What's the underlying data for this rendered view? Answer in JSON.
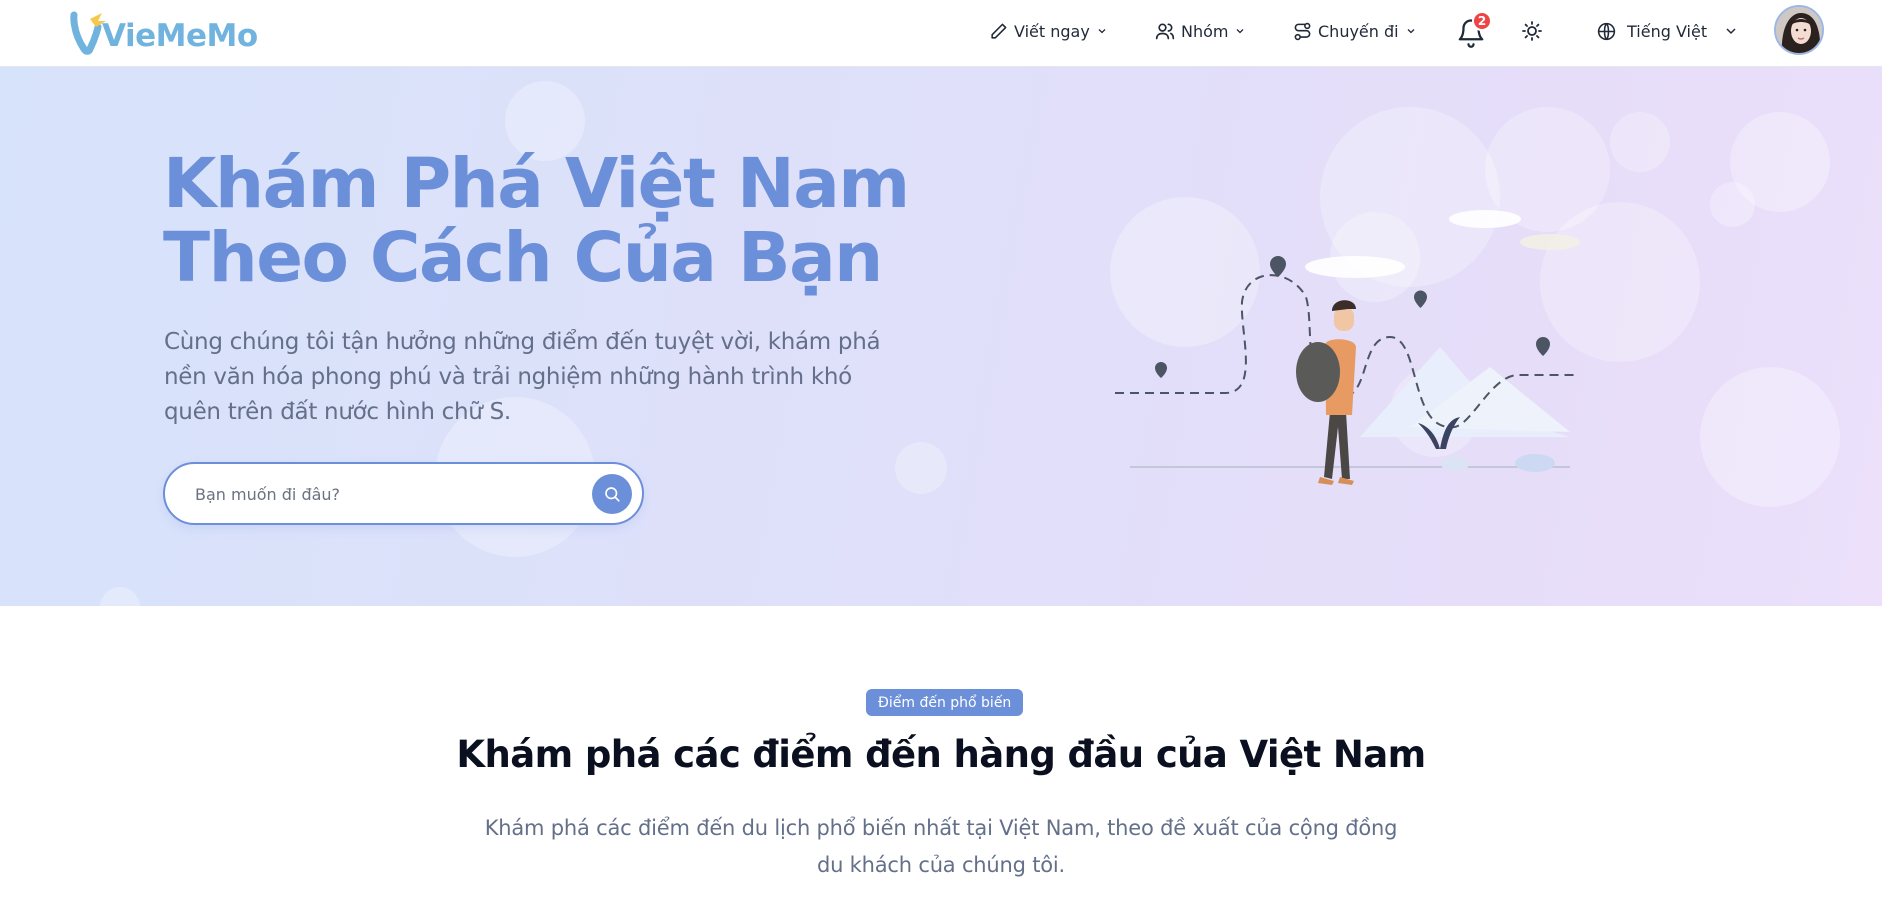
{
  "brand": {
    "logo_text": "VieMeMo"
  },
  "nav": {
    "write_label": "Viết ngay",
    "group_label": "Nhóm",
    "trip_label": "Chuyến đi",
    "notification_count": "2",
    "language_label": "Tiếng Việt"
  },
  "hero": {
    "title_line1": "Khám Phá Việt Nam",
    "title_line2": "Theo Cách Của Bạn",
    "subtitle": "Cùng chúng tôi tận hưởng những điểm đến tuyệt vời, khám phá nền văn hóa phong phú và trải nghiệm những hành trình khó quên trên đất nước hình chữ S.",
    "search_placeholder": "Bạn muốn đi đâu?"
  },
  "section": {
    "badge": "Điểm đến phổ biến",
    "title": "Khám phá các điểm đến hàng đầu của Việt Nam",
    "description": "Khám phá các điểm đến du lịch phổ biến nhất tại Việt Nam, theo đề xuất của cộng đồng du khách của chúng tôi."
  },
  "colors": {
    "accent": "#6b8fd9",
    "logo": "#6fb3de",
    "badge_notification": "#ef4444"
  },
  "icons": {
    "logo": "map-pin-plane-icon",
    "write": "pencil-icon",
    "group": "users-icon",
    "trip": "route-icon",
    "notification": "bell-icon",
    "theme": "sun-icon",
    "language": "globe-icon",
    "search": "search-icon"
  }
}
